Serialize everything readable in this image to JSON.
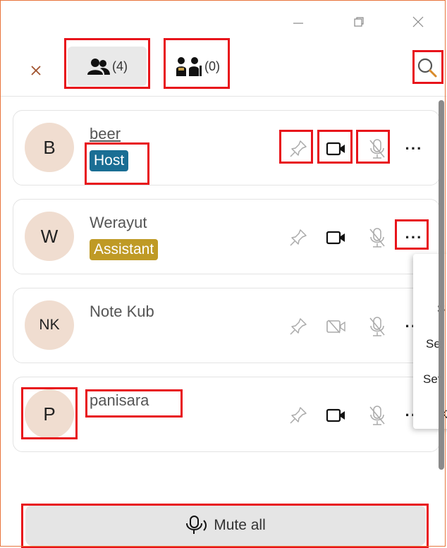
{
  "colors": {
    "window_border": "#e8743b",
    "host_badge": "#1a6e94",
    "assistant_badge": "#bf9a25",
    "highlight": "#e8141b",
    "avatar_bg": "#f0ddd0"
  },
  "titlebar": {
    "minimize_icon": "minimize-icon",
    "restore_icon": "restore-icon",
    "close_icon": "close-icon"
  },
  "toolbar": {
    "close_icon": "close-icon",
    "tabs": [
      {
        "icon": "participants-icon",
        "count": "(4)"
      },
      {
        "icon": "waiting-room-icon",
        "count": "(0)"
      }
    ],
    "search_icon": "search-icon"
  },
  "participants": [
    {
      "initial": "B",
      "name": "beer",
      "role": "Host",
      "camera": "on",
      "mic": "muted"
    },
    {
      "initial": "W",
      "name": "Werayut",
      "role": "Assistant",
      "camera": "on",
      "mic": "muted"
    },
    {
      "initial": "NK",
      "name": "Note Kub",
      "role": "",
      "camera": "off",
      "mic": "muted"
    },
    {
      "initial": "P",
      "name": "panisara",
      "role": "",
      "camera": "on",
      "mic": "muted"
    }
  ],
  "popup_menu": {
    "items": [
      "S",
      "Set",
      "Set",
      "K"
    ]
  },
  "footer": {
    "mute_all_label": "Mute all"
  }
}
